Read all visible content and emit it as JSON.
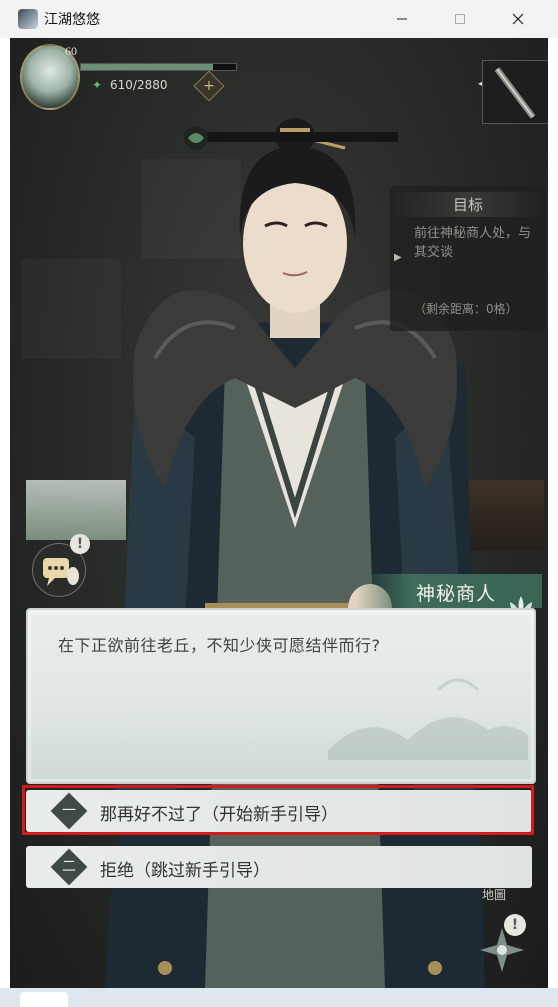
{
  "window": {
    "title": "江湖悠悠",
    "minimize_icon": "minimize-icon",
    "maximize_icon": "maximize-icon",
    "close_icon": "close-icon"
  },
  "hud": {
    "level": "60",
    "stamina": "610/2880",
    "exp_fraction": 0.85,
    "plus_label": "+"
  },
  "objective": {
    "title": "目标",
    "text": "前往神秘商人处，与其交谈",
    "remaining": "（剩余距离：0格）"
  },
  "npc": {
    "name": "神秘商人"
  },
  "dialog": {
    "text": "在下正欲前往老丘，不知少侠可愿结伴而行?"
  },
  "choices": [
    {
      "num": "一",
      "label": "那再好不过了（开始新手引导）"
    },
    {
      "num": "二",
      "label": "拒绝（跳过新手引导）"
    }
  ],
  "map": {
    "label": "地圖",
    "alert": "!"
  },
  "chat": {
    "alert": "!"
  },
  "colors": {
    "accent": "#3f6b5a",
    "highlight": "#d41a1a"
  }
}
